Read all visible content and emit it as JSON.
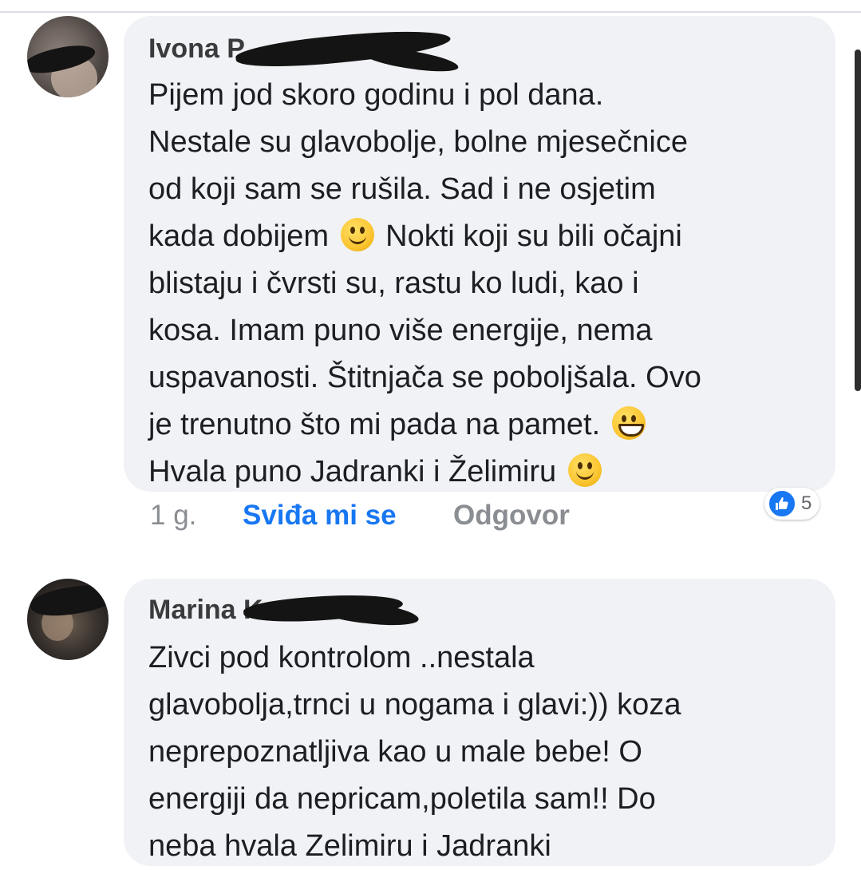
{
  "comments": [
    {
      "author": "Ivona P",
      "lines": [
        "Pijem jod skoro godinu i pol dana.",
        "Nestale su glavobolje, bolne mjesečnice",
        "od koji sam se rušila. Sad i ne osjetim",
        "kada dobijem",
        "Nokti koji su bili očajni",
        "blistaju i čvrsti su, rastu ko ludi, kao i",
        "kosa. Imam puno više energije, nema",
        "uspavanosti. Štitnjača se poboljšala. Ovo",
        "je trenutno što mi pada na pamet.",
        "Hvala puno Jadranki i Želimiru"
      ],
      "time": "1 g.",
      "like_label": "Sviđa mi se",
      "reply_label": "Odgovor",
      "reaction_icon": "like-icon",
      "reaction_count": "5"
    },
    {
      "author": "Marina K",
      "lines": [
        "Zivci pod kontrolom ..nestala",
        "glavobolja,trnci u nogama i glavi:)) koza",
        "neprepoznatljiva kao u male bebe!  O",
        "energiji da nepricam,poletila sam!! Do",
        "neba hvala Zelimiru i  Jadranki"
      ]
    }
  ],
  "colors": {
    "bubble": "#f0f2f5",
    "like_blue": "#1877f2",
    "meta_gray": "#8a8d91"
  }
}
